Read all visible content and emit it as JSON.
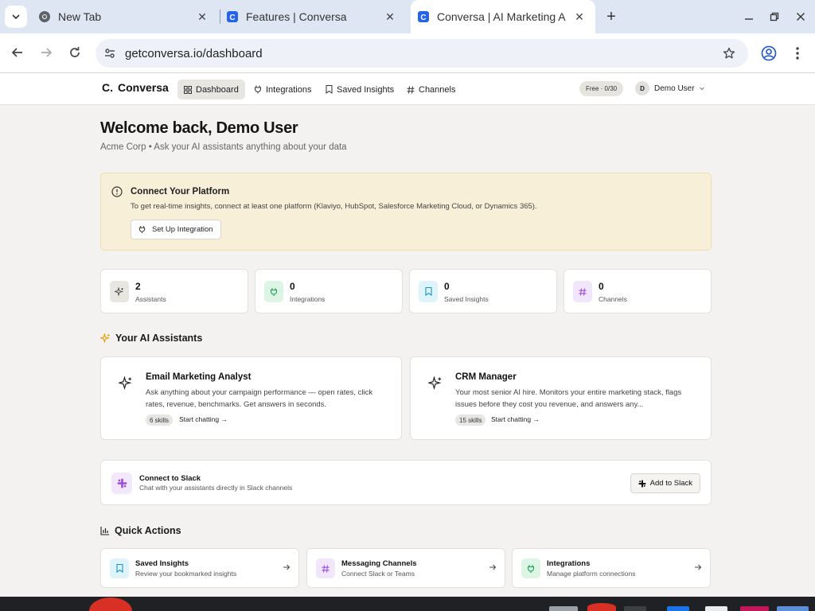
{
  "browser": {
    "tabs": [
      {
        "title": "New Tab",
        "favicon": "chrome-icon"
      },
      {
        "title": "Features | Conversa",
        "favicon": "conversa-icon"
      },
      {
        "title": "Conversa | AI Marketing A",
        "favicon": "conversa-icon",
        "active": true
      }
    ],
    "url": "getconversa.io/dashboard"
  },
  "header": {
    "logo": "Conversa",
    "logo_mark": "C.",
    "nav": [
      {
        "label": "Dashboard",
        "icon": "grid-icon",
        "active": true
      },
      {
        "label": "Integrations",
        "icon": "plug-icon"
      },
      {
        "label": "Saved Insights",
        "icon": "bookmark-icon"
      },
      {
        "label": "Channels",
        "icon": "hash-icon"
      }
    ],
    "plan": "Free · 0/30",
    "user": {
      "initial": "D",
      "name": "Demo User"
    }
  },
  "main": {
    "title": "Welcome back, Demo User",
    "subtitle": "Acme Corp • Ask your AI assistants anything about your data",
    "alert": {
      "title": "Connect Your Platform",
      "text": "To get real-time insights, connect at least one platform (Klaviyo, HubSpot, Salesforce Marketing Cloud, or Dynamics 365).",
      "button": "Set Up Integration"
    },
    "stats": [
      {
        "value": "2",
        "label": "Assistants",
        "icon": "sparkle-icon",
        "color": "#e8e6e1"
      },
      {
        "value": "0",
        "label": "Integrations",
        "icon": "plug-icon",
        "color": "#dcf5e4"
      },
      {
        "value": "0",
        "label": "Saved Insights",
        "icon": "bookmark-icon",
        "color": "#dff3fa"
      },
      {
        "value": "0",
        "label": "Channels",
        "icon": "hash-icon",
        "color": "#f1e6fb"
      }
    ],
    "assistants_title": "Your AI Assistants",
    "assistants": [
      {
        "name": "Email Marketing Analyst",
        "description": "Ask anything about your campaign performance — open rates, click rates, revenue, benchmarks. Get answers in seconds.",
        "skills": "6 skills",
        "cta": "Start chatting"
      },
      {
        "name": "CRM Manager",
        "description": "Your most senior AI hire. Monitors your entire marketing stack, flags issues before they cost you revenue, and answers any...",
        "skills": "15 skills",
        "cta": "Start chatting"
      }
    ],
    "slack": {
      "title": "Connect to Slack",
      "subtitle": "Chat with your assistants directly in Slack channels",
      "button": "Add to Slack"
    },
    "quick_actions_title": "Quick Actions",
    "quick_actions": [
      {
        "title": "Saved Insights",
        "subtitle": "Review your bookmarked insights",
        "icon": "bookmark-icon",
        "color": "#dff3fa"
      },
      {
        "title": "Messaging Channels",
        "subtitle": "Connect Slack or Teams",
        "icon": "hash-icon",
        "color": "#f1e6fb"
      },
      {
        "title": "Integrations",
        "subtitle": "Manage platform connections",
        "icon": "plug-icon",
        "color": "#dcf5e4"
      }
    ]
  }
}
